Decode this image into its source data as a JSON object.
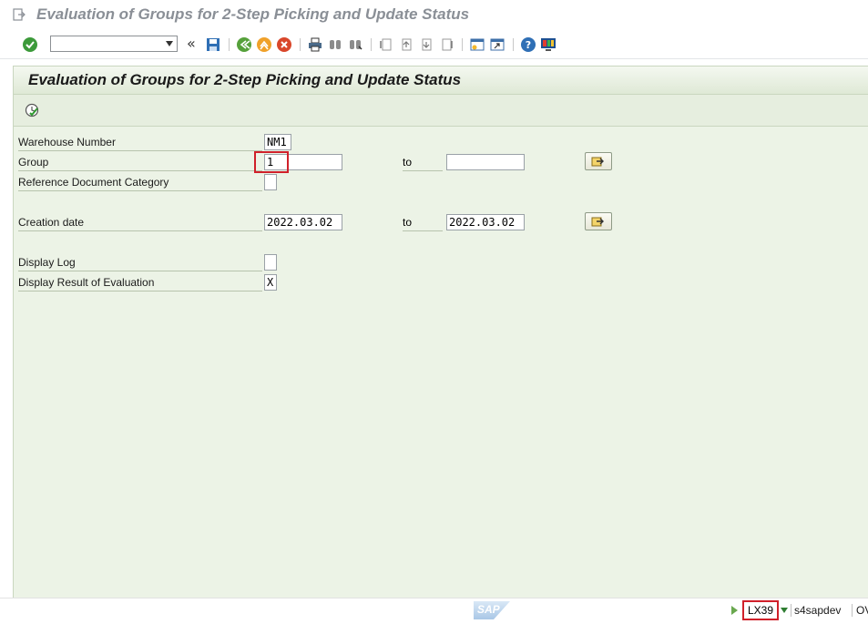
{
  "window": {
    "title": "Evaluation of Groups for 2-Step Picking and Update Status"
  },
  "toolbar": {
    "command_field_value": "",
    "icons": [
      "check-icon",
      "back-double-icon",
      "save-icon",
      "back-icon",
      "exit-icon",
      "cancel-icon",
      "print-icon",
      "find-icon",
      "find-next-icon",
      "first-page-icon",
      "previous-page-icon",
      "next-page-icon",
      "last-page-icon",
      "create-session-icon",
      "shortcut-icon",
      "help-icon",
      "customize-layout-icon"
    ]
  },
  "screen": {
    "title": "Evaluation of Groups for 2-Step Picking and Update Status",
    "execute_icon": "execute-clock-icon"
  },
  "form": {
    "warehouse_number": {
      "label": "Warehouse Number",
      "value": "NM1"
    },
    "group": {
      "label": "Group",
      "from": "1",
      "to_label": "to",
      "to": ""
    },
    "reference_document_category": {
      "label": "Reference Document Category",
      "value": ""
    },
    "creation_date": {
      "label": "Creation date",
      "from": "2022.03.02",
      "to_label": "to",
      "to": "2022.03.02"
    },
    "display_log": {
      "label": "Display Log",
      "value": ""
    },
    "display_result": {
      "label": "Display Result of Evaluation",
      "value": "X"
    }
  },
  "statusbar": {
    "logo_text": "SAP",
    "transaction": "LX39",
    "system": "s4sapdev",
    "mode": "OV"
  },
  "colors": {
    "panel_bg": "#ecf3e6",
    "highlight": "#d0202a",
    "title_gray": "#8a8f96"
  }
}
